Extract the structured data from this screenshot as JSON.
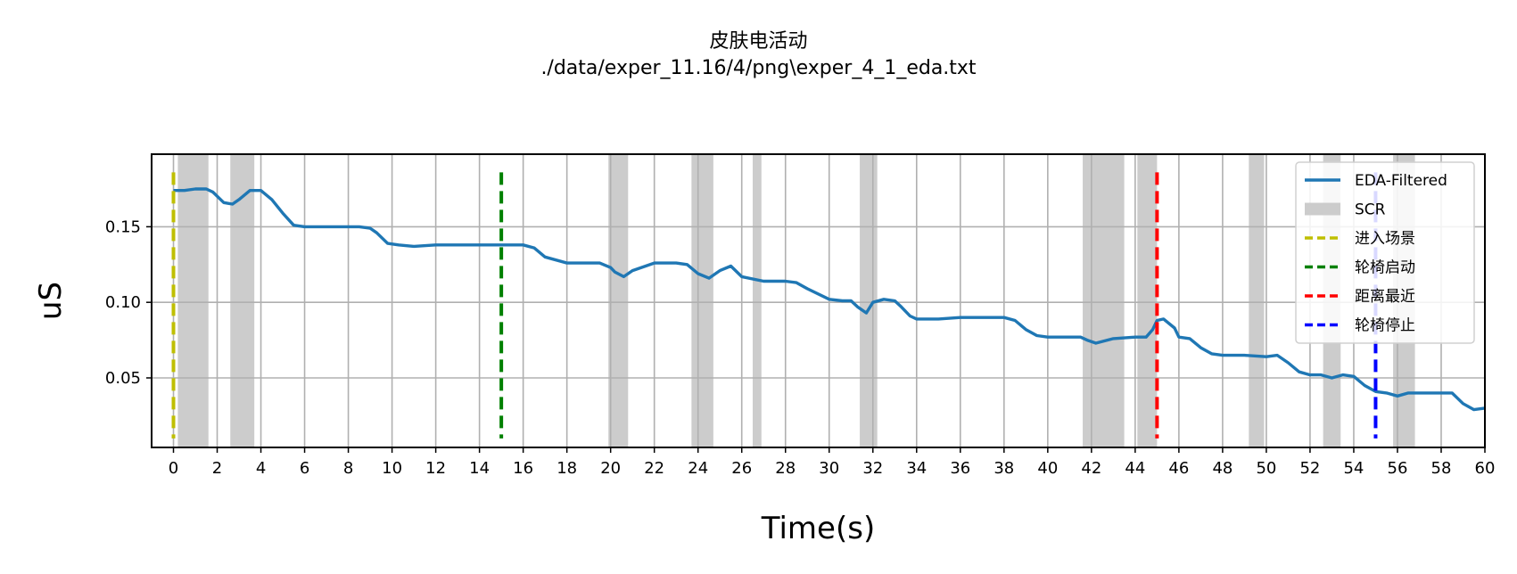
{
  "chart_data": {
    "type": "line",
    "title": "皮肤电活动",
    "subtitle": "./data/exper_11.16/4/png\\exper_4_1_eda.txt",
    "xlabel": "Time(s)",
    "ylabel": "uS",
    "xlim": [
      -1,
      60
    ],
    "ylim": [
      0.004,
      0.198
    ],
    "xticks": [
      0,
      2,
      4,
      6,
      8,
      10,
      12,
      14,
      16,
      18,
      20,
      22,
      24,
      26,
      28,
      30,
      32,
      34,
      36,
      38,
      40,
      42,
      44,
      46,
      48,
      50,
      52,
      54,
      56,
      58,
      60
    ],
    "yticks": [
      0.05,
      0.1,
      0.15
    ],
    "ytick_labels": [
      "0.05",
      "0.10",
      "0.15"
    ],
    "grid": true,
    "legend_position": "top-right",
    "legend": [
      "EDA-Filtered",
      "SCR",
      "进入场景",
      "轮椅启动",
      "距离最近",
      "轮椅停止"
    ],
    "colors": {
      "eda": "#1f77b4",
      "scr": "#cccccc",
      "enter": "#bfbf00",
      "start": "#008000",
      "closest": "#ff0000",
      "stop": "#0000ff",
      "grid": "#b0b0b0"
    },
    "series": [
      {
        "name": "EDA-Filtered",
        "x": [
          0,
          0.5,
          1,
          1.5,
          1.8,
          2.3,
          2.7,
          3.0,
          3.5,
          4.0,
          4.5,
          5.0,
          5.5,
          6.0,
          6.5,
          7.0,
          8.0,
          8.5,
          9.0,
          9.3,
          9.8,
          10.3,
          11.0,
          12.0,
          13.0,
          14.0,
          15.0,
          15.5,
          16.0,
          16.5,
          17.0,
          18.0,
          19.0,
          19.5,
          20.0,
          20.2,
          20.6,
          21.0,
          22.0,
          22.5,
          23.0,
          23.5,
          24.0,
          24.5,
          25.0,
          25.5,
          26.0,
          27.0,
          28.0,
          28.5,
          29.0,
          30.0,
          30.6,
          31.0,
          31.3,
          31.7,
          32.0,
          32.5,
          33.0,
          33.3,
          33.7,
          34.0,
          35.0,
          36.0,
          37.0,
          38.0,
          38.5,
          39.0,
          39.5,
          40.0,
          41.0,
          41.5,
          41.8,
          42.2,
          43.0,
          44.0,
          44.5,
          44.8,
          45.0,
          45.3,
          45.8,
          46.0,
          46.5,
          47.0,
          47.5,
          48.0,
          49.0,
          50.0,
          50.5,
          51.0,
          51.5,
          52.0,
          52.5,
          53.0,
          53.5,
          54.0,
          54.5,
          55.0,
          55.5,
          56.0,
          56.5,
          57.0,
          58.0,
          58.5,
          59.0,
          59.5,
          60.0
        ],
        "y": [
          0.174,
          0.174,
          0.175,
          0.175,
          0.173,
          0.166,
          0.165,
          0.168,
          0.174,
          0.174,
          0.168,
          0.159,
          0.151,
          0.15,
          0.15,
          0.15,
          0.15,
          0.15,
          0.149,
          0.146,
          0.139,
          0.138,
          0.137,
          0.138,
          0.138,
          0.138,
          0.138,
          0.138,
          0.138,
          0.136,
          0.13,
          0.126,
          0.126,
          0.126,
          0.123,
          0.12,
          0.117,
          0.121,
          0.126,
          0.126,
          0.126,
          0.125,
          0.119,
          0.116,
          0.121,
          0.124,
          0.117,
          0.114,
          0.114,
          0.113,
          0.109,
          0.102,
          0.101,
          0.101,
          0.097,
          0.093,
          0.1,
          0.102,
          0.101,
          0.097,
          0.091,
          0.089,
          0.089,
          0.09,
          0.09,
          0.09,
          0.088,
          0.082,
          0.078,
          0.077,
          0.077,
          0.077,
          0.075,
          0.073,
          0.076,
          0.077,
          0.077,
          0.082,
          0.088,
          0.089,
          0.083,
          0.077,
          0.076,
          0.07,
          0.066,
          0.065,
          0.065,
          0.064,
          0.065,
          0.06,
          0.054,
          0.052,
          0.052,
          0.05,
          0.052,
          0.051,
          0.045,
          0.041,
          0.04,
          0.038,
          0.04,
          0.04,
          0.04,
          0.04,
          0.033,
          0.029,
          0.03
        ]
      }
    ],
    "scr_intervals": [
      [
        0.2,
        1.6
      ],
      [
        2.6,
        3.7
      ],
      [
        19.9,
        20.8
      ],
      [
        23.7,
        24.7
      ],
      [
        26.5,
        26.9
      ],
      [
        31.4,
        32.2
      ],
      [
        41.6,
        43.5
      ],
      [
        44.1,
        45.0
      ],
      [
        49.2,
        49.9
      ],
      [
        52.6,
        53.4
      ],
      [
        55.8,
        56.8
      ]
    ],
    "events": [
      {
        "name": "进入场景",
        "x": 0,
        "color": "#bfbf00",
        "y_range": [
          0.01,
          0.186
        ]
      },
      {
        "name": "轮椅启动",
        "x": 15,
        "color": "#008000",
        "y_range": [
          0.01,
          0.186
        ]
      },
      {
        "name": "距离最近",
        "x": 45,
        "color": "#ff0000",
        "y_range": [
          0.01,
          0.186
        ]
      },
      {
        "name": "轮椅停止",
        "x": 55,
        "color": "#0000ff",
        "y_range": [
          0.01,
          0.186
        ]
      }
    ]
  }
}
